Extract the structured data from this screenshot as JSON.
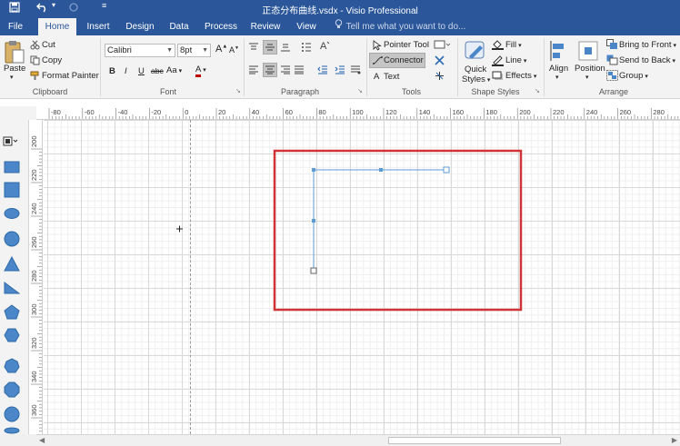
{
  "window": {
    "title": "正态分布曲线.vsdx - Visio Professional"
  },
  "quick_access": {
    "save_icon": "save-icon",
    "undo_icon": "undo-icon",
    "redo_icon": "redo-icon",
    "customize_icon": "customize-qat-icon"
  },
  "tabs": [
    {
      "label": "File"
    },
    {
      "label": "Home",
      "active": true
    },
    {
      "label": "Insert"
    },
    {
      "label": "Design"
    },
    {
      "label": "Data"
    },
    {
      "label": "Process"
    },
    {
      "label": "Review"
    },
    {
      "label": "View"
    }
  ],
  "tell_me": "Tell me what you want to do...",
  "clipboard": {
    "paste": "Paste",
    "cut": "Cut",
    "copy": "Copy",
    "format_painter": "Format Painter",
    "group_label": "Clipboard"
  },
  "font": {
    "name": "Calibri",
    "size": "8pt",
    "bold": "B",
    "italic": "I",
    "underline": "U",
    "strike": "abc",
    "case": "Aa",
    "color_letter": "A",
    "grow": "A",
    "group_label": "Font"
  },
  "paragraph": {
    "group_label": "Paragraph"
  },
  "tools": {
    "pointer": "Pointer Tool",
    "connector": "Connector",
    "text": "Text",
    "text_icon": "A",
    "group_label": "Tools"
  },
  "shape_styles": {
    "quick_styles": "Quick",
    "quick_styles2": "Styles",
    "fill": "Fill",
    "line": "Line",
    "effects": "Effects",
    "group_label": "Shape Styles"
  },
  "arrange": {
    "align": "Align",
    "position": "Position",
    "bring_front": "Bring to Front",
    "send_back": "Send to Back",
    "group": "Group",
    "group_label": "Arrange"
  },
  "ruler_top_labels": [
    "-80",
    "-60",
    "-40",
    "-20",
    "0",
    "20",
    "40",
    "60",
    "80",
    "100",
    "120",
    "140",
    "160",
    "180",
    "200",
    "220",
    "240",
    "260",
    "280"
  ],
  "ruler_left_labels": [
    "200",
    "220",
    "240",
    "260",
    "280",
    "300",
    "320",
    "340",
    "360"
  ],
  "colors": {
    "accent": "#2b579a",
    "highlight_box": "#d13438",
    "connector": "#5b9bd5",
    "shape_fill": "#4a86c8"
  }
}
